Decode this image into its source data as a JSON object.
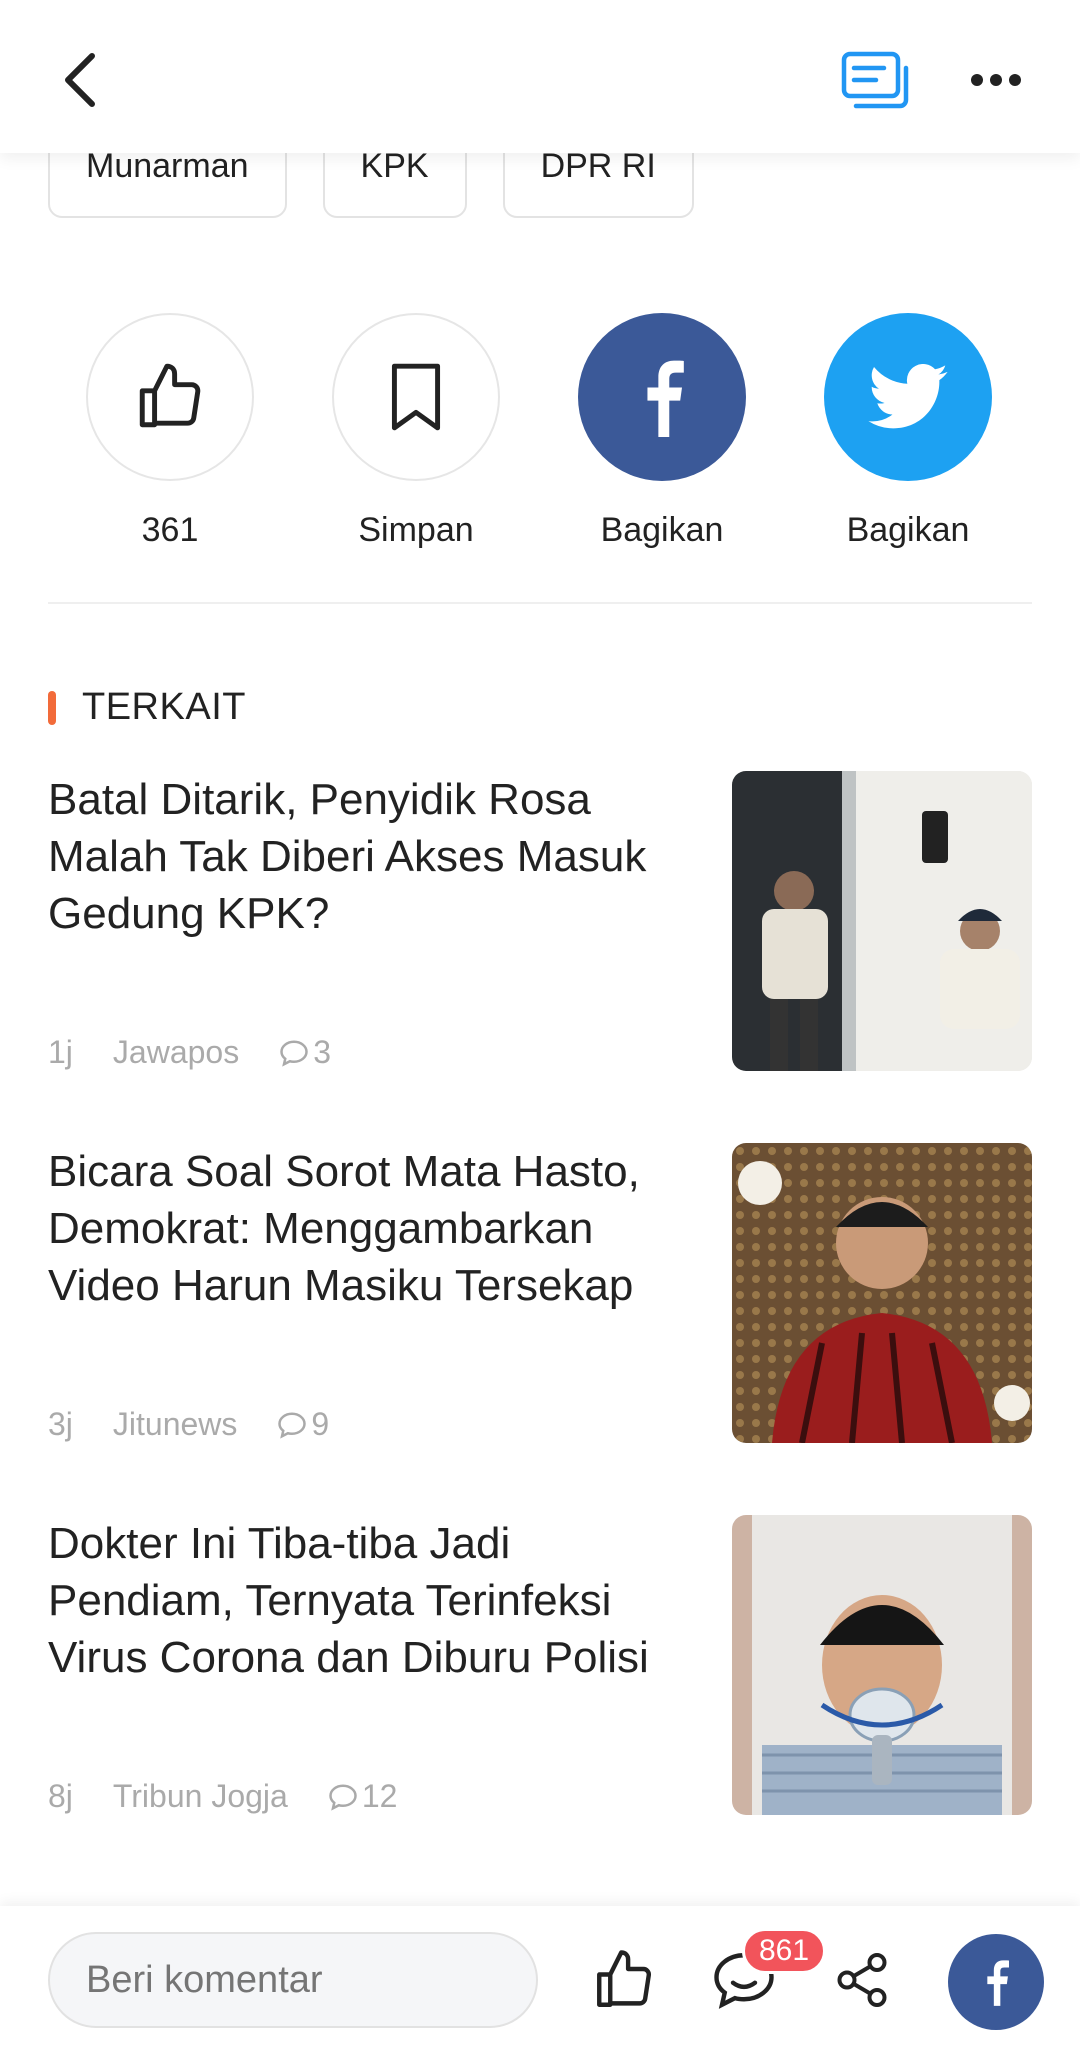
{
  "topbar": {
    "back_icon": "chevron-left-icon",
    "comments_icon": "comments-icon",
    "more_icon": "more-horizontal-icon",
    "accent": "#2196f3"
  },
  "tags": [
    "Munarman",
    "KPK",
    "DPR RI"
  ],
  "actions": {
    "like_count": "361",
    "save_label": "Simpan",
    "facebook_label": "Bagikan",
    "twitter_label": "Bagikan",
    "facebook_color": "#3b5998",
    "twitter_color": "#1da1f2"
  },
  "related": {
    "title": "TERKAIT",
    "accent": "#f26b3a",
    "articles": [
      {
        "headline": "Batal Ditarik, Penyidik Rosa Malah Tak Diberi Akses Masuk Gedung KPK?",
        "age": "1j",
        "source": "Jawapos",
        "comments": "3"
      },
      {
        "headline": "Bicara Soal Sorot Mata Hasto, Demokrat: Menggambarkan Video Harun Masiku Tersekap",
        "age": "3j",
        "source": "Jitunews",
        "comments": "9"
      },
      {
        "headline": "Dokter Ini Tiba-tiba Jadi Pendiam, Ternyata Terinfeksi Virus Corona dan Diburu Polisi",
        "age": "8j",
        "source": "Tribun Jogja",
        "comments": "12"
      }
    ]
  },
  "bottombar": {
    "comment_placeholder": "Beri komentar",
    "comment_badge": "861",
    "badge_color": "#f2545b"
  }
}
